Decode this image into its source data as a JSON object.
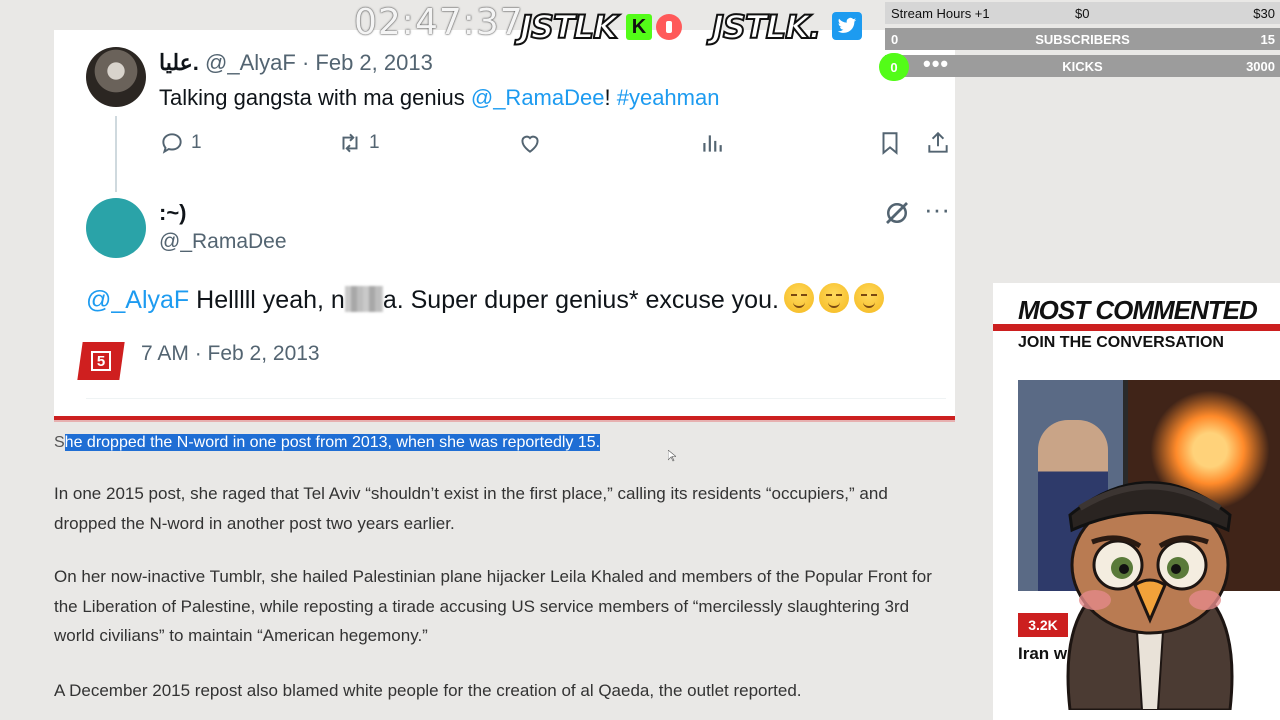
{
  "tweet1": {
    "display_name": "عليا.",
    "handle": "@_AlyaF",
    "dot": "·",
    "date": "Feb 2, 2013",
    "text_before": "Talking gangsta with ma genius ",
    "mention": "@_RamaDee",
    "text_mid": "! ",
    "hashtag": "#yeahman",
    "reply_count": "1",
    "retweet_count": "1"
  },
  "tweet2": {
    "display_name": ":~)",
    "handle": "@_RamaDee",
    "mention": "@_AlyaF",
    "text_part1": " Helllll yeah, n",
    "text_part2": "a. Super duper genius* excuse you.",
    "timestamp": "7 AM · Feb 2, 2013",
    "badge": "5"
  },
  "article": {
    "caption_first_letter": "S",
    "caption_selected": "he dropped the N-word in one post from 2013, when she was reportedly 15.",
    "para1": "In one 2015 post, she raged that Tel Aviv “shouldn’t exist in the first place,” calling its residents “occupiers,” and dropped the N-word in another post two years earlier.",
    "para2": "On her now-inactive Tumblr, she hailed Palestinian plane hijacker Leila Khaled and members of the Popular Front for the Liberation of Palestine, while reposting a tirade accusing US service members of “mercilessly slaughtering 3rd world civilians” to maintain “American hegemony.”",
    "para3": "A December 2015 repost also blamed white people for the creation of al Qaeda, the outlet reported."
  },
  "overlay": {
    "clock": "02:47:37",
    "brand_left": "JSTLK",
    "brand_right": "JSTLK.",
    "kick_letter": "K",
    "goals": {
      "stream_hours_label": "Stream Hours +1",
      "stream_hours_amount": "$0",
      "stream_hours_target": "$30",
      "subs_current": "0",
      "subs_label": "SUBSCRIBERS",
      "subs_target": "15",
      "kicks_current": "0",
      "kicks_dots": "•••",
      "kicks_label": "KICKS",
      "kicks_target": "3000"
    }
  },
  "sidebar": {
    "title": "MOST COMMENTED",
    "subtitle": "JOIN THE CONVERSATION",
    "comment_count": "3.2K",
    "headline": "Iran wrestl hanging"
  },
  "colors": {
    "accent_red": "#cc1f1f",
    "twitter_blue": "#1d9bf0",
    "kick_green": "#53fc18",
    "selection_blue": "#1f6ed4"
  }
}
